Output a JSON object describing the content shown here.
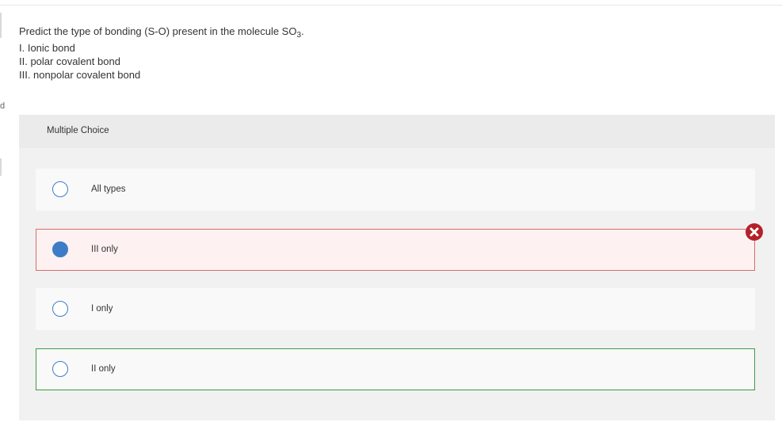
{
  "question": {
    "stem_prefix": "Predict the type of bonding (S-O) present in the molecule SO",
    "stem_subscript": "3",
    "stem_suffix": ".",
    "statements": [
      "I. Ionic bond",
      "II. polar covalent bond",
      "III. nonpolar covalent bond"
    ]
  },
  "sidebar_fragment": {
    "letter": "d"
  },
  "panel": {
    "header_label": "Multiple Choice"
  },
  "options": [
    {
      "label": "All types",
      "selected": false,
      "state": "neutral"
    },
    {
      "label": "III only",
      "selected": true,
      "state": "incorrect"
    },
    {
      "label": "I only",
      "selected": false,
      "state": "neutral"
    },
    {
      "label": "II only",
      "selected": false,
      "state": "correct"
    }
  ],
  "colors": {
    "accent_blue": "#3d7dc8",
    "incorrect_border": "#d86b6b",
    "incorrect_bg": "#fdf1f1",
    "correct_border": "#3f9b48",
    "error_icon": "#b32128"
  },
  "icons": {
    "incorrect_indicator": "x-circle-icon"
  }
}
